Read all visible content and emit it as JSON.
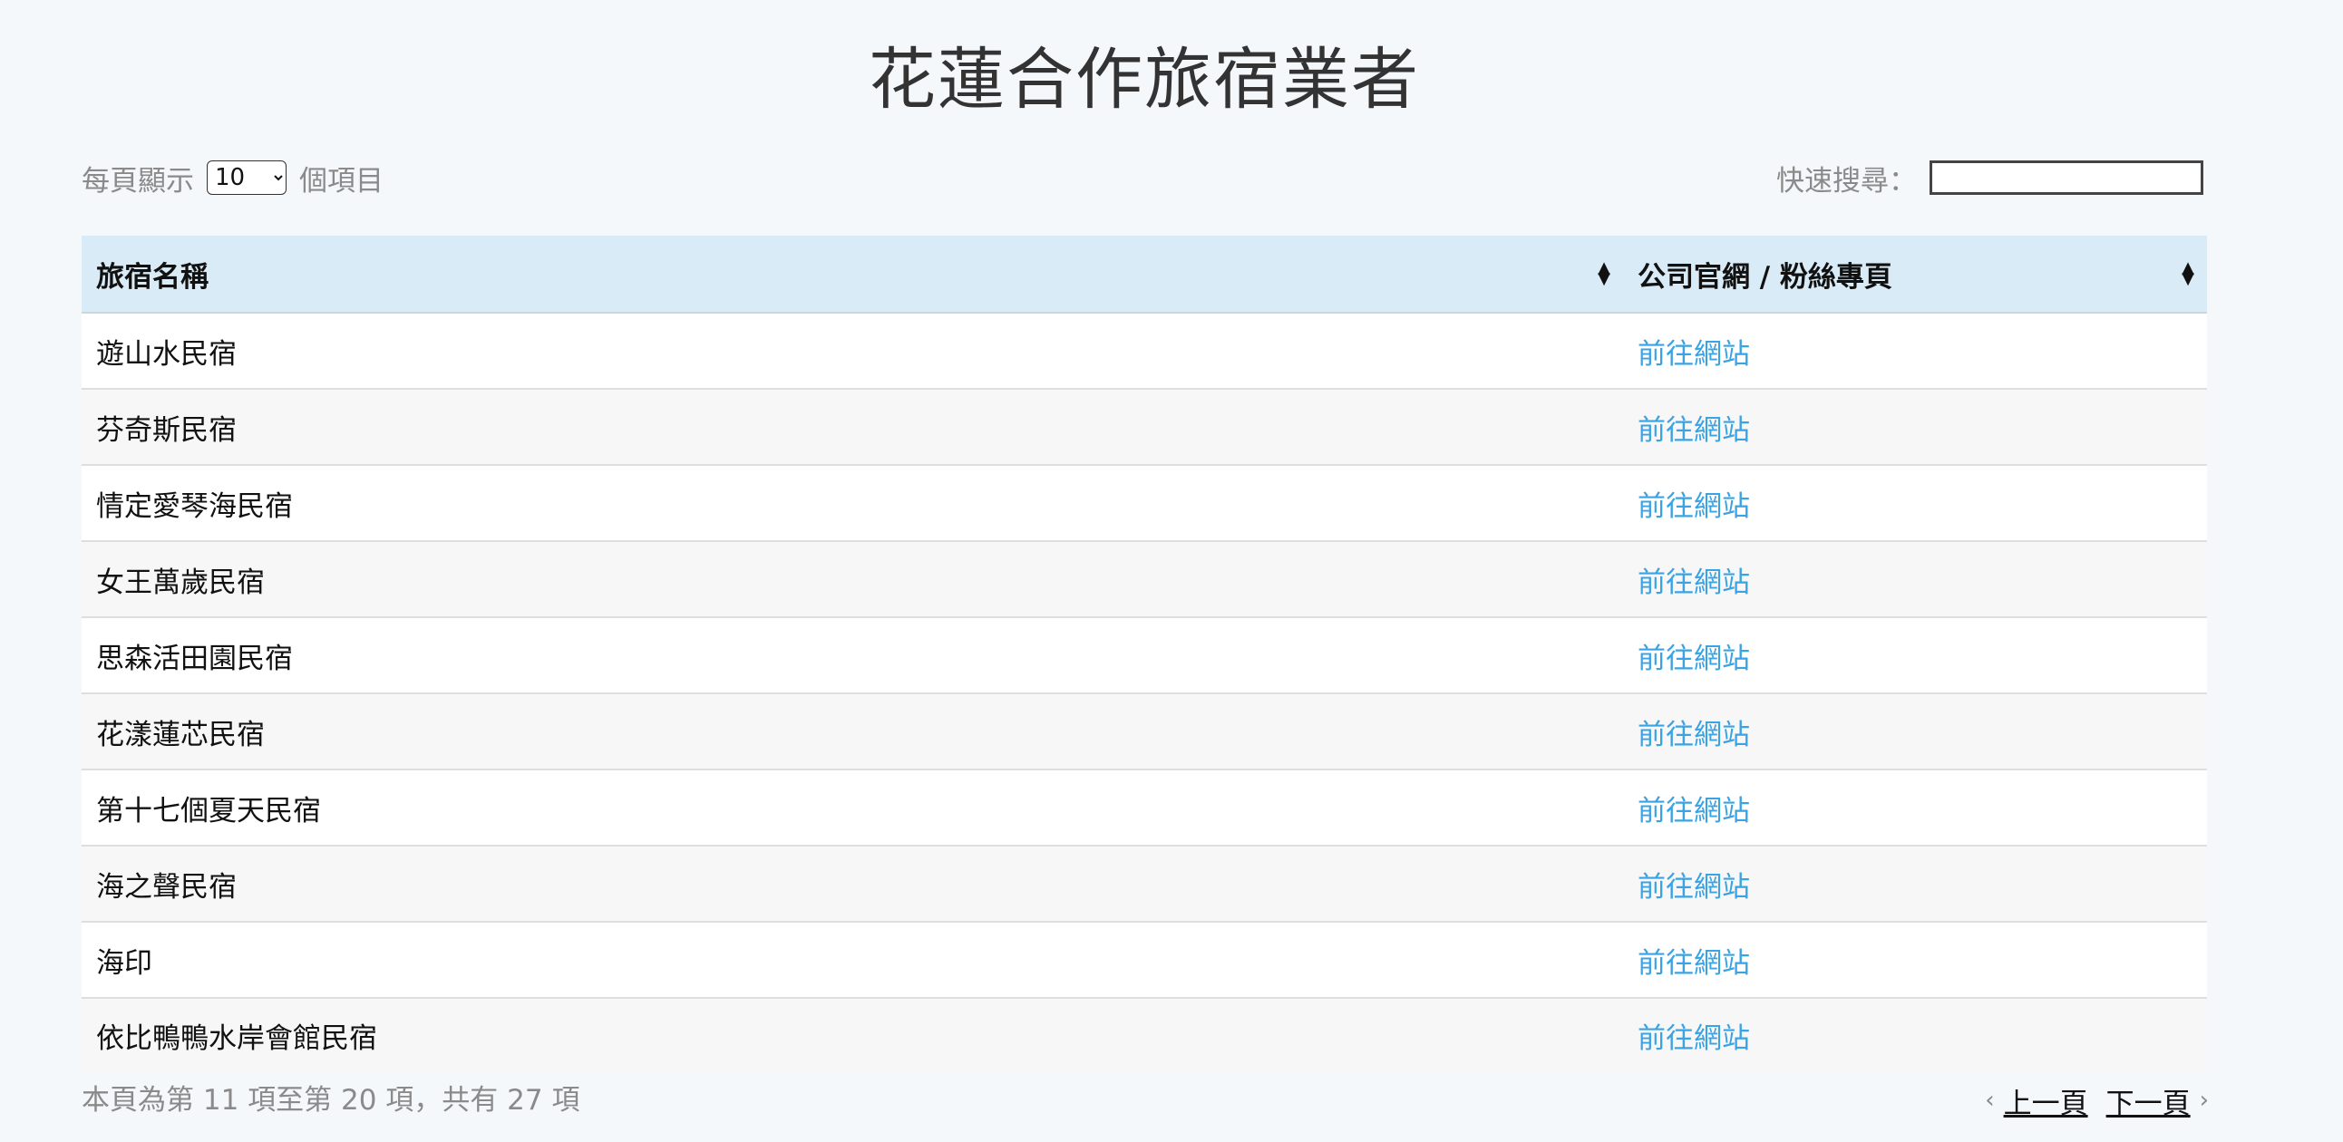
{
  "page": {
    "title": "花蓮合作旅宿業者"
  },
  "length": {
    "prefix": "每頁顯示",
    "selected": "10",
    "suffix": "個項目"
  },
  "filter": {
    "label": "快速搜尋："
  },
  "table": {
    "headers": [
      "旅宿名稱",
      "公司官網 / 粉絲專頁"
    ],
    "rows": [
      {
        "name": "遊山水民宿",
        "link": "前往網站"
      },
      {
        "name": "芬奇斯民宿",
        "link": "前往網站"
      },
      {
        "name": "情定愛琴海民宿",
        "link": "前往網站"
      },
      {
        "name": "女王萬歲民宿",
        "link": "前往網站"
      },
      {
        "name": "思森活田園民宿",
        "link": "前往網站"
      },
      {
        "name": "花漾蓮芯民宿",
        "link": "前往網站"
      },
      {
        "name": "第十七個夏天民宿",
        "link": "前往網站"
      },
      {
        "name": "海之聲民宿",
        "link": "前往網站"
      },
      {
        "name": "海印",
        "link": "前往網站"
      },
      {
        "name": "依比鴨鴨水岸會館民宿",
        "link": "前往網站"
      }
    ]
  },
  "info": {
    "text": "本頁為第 11 項至第 20 項，共有 27 項"
  },
  "pagination": {
    "prev_label": "上一頁",
    "next_label": "下一頁",
    "prev_icon": "chevron-left-icon",
    "next_icon": "chevron-right-icon"
  },
  "colors": {
    "background": "#f4f8fb",
    "header_bg": "#d9ebf6",
    "link": "#3aa3e3",
    "muted_text": "#8a8a8a"
  }
}
